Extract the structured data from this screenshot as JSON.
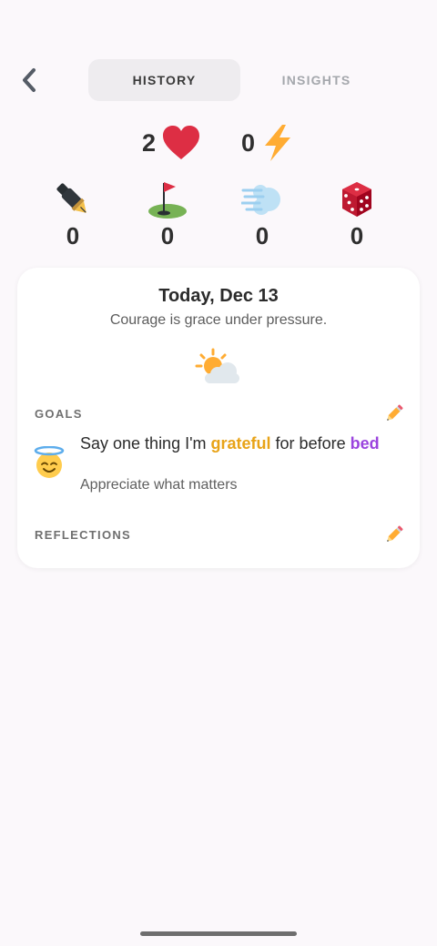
{
  "header": {
    "tabs": [
      {
        "label": "HISTORY",
        "active": true
      },
      {
        "label": "INSIGHTS",
        "active": false
      }
    ]
  },
  "stats": {
    "hearts": "2",
    "bolts": "0",
    "counters": [
      {
        "icon": "pen-icon",
        "value": "0"
      },
      {
        "icon": "golf-flag-icon",
        "value": "0"
      },
      {
        "icon": "wind-icon",
        "value": "0"
      },
      {
        "icon": "dice-icon",
        "value": "0"
      }
    ]
  },
  "day_card": {
    "date": "Today, Dec 13",
    "quote": "Courage is grace under pressure.",
    "weather_icon": "sun-behind-cloud-icon",
    "goals_label": "GOALS",
    "goal": {
      "text_before": "Say one thing I'm ",
      "highlight_1": "grateful",
      "text_middle": " for before ",
      "highlight_2": "bed",
      "subtitle": "Appreciate what matters",
      "icon": "smiling-face-with-halo-icon"
    },
    "reflections_label": "REFLECTIONS"
  },
  "colors": {
    "background": "#fbf8fb",
    "highlight_orange": "#e8a317",
    "highlight_purple": "#9b44de"
  }
}
